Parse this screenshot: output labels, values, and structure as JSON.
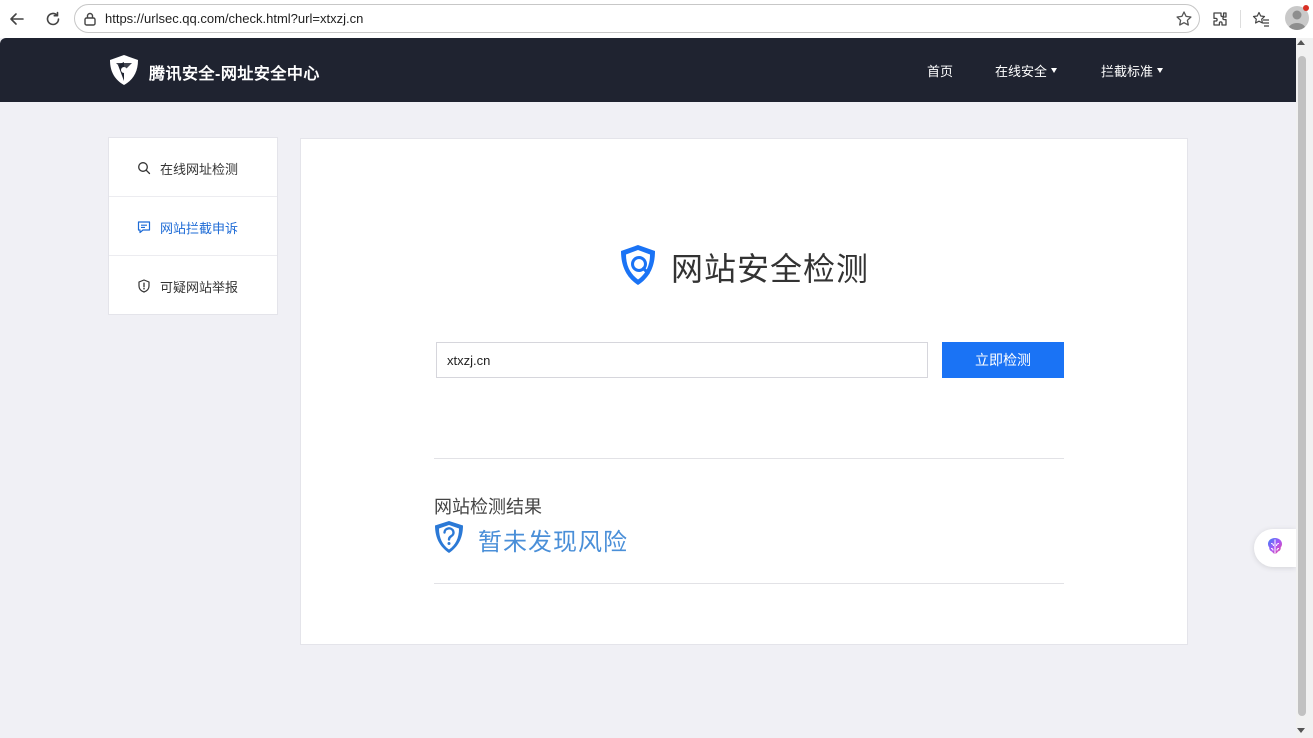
{
  "browser": {
    "url": "https://urlsec.qq.com/check.html?url=xtxzj.cn",
    "icons": [
      "back-arrow-icon",
      "reload-icon",
      "lock-icon",
      "star-icon",
      "extensions-icon",
      "favorites-icon",
      "profile-icon"
    ]
  },
  "header": {
    "brand": "腾讯安全-网址安全中心",
    "nav": [
      {
        "label": "首页",
        "dropdown": false
      },
      {
        "label": "在线安全",
        "dropdown": true
      },
      {
        "label": "拦截标准",
        "dropdown": true
      }
    ]
  },
  "sidebar": {
    "items": [
      {
        "label": "在线网址检测",
        "icon": "search-icon",
        "active": false
      },
      {
        "label": "网站拦截申诉",
        "icon": "message-icon",
        "active": true
      },
      {
        "label": "可疑网站举报",
        "icon": "shield-alert-icon",
        "active": false
      }
    ]
  },
  "main": {
    "title": "网站安全检测",
    "search": {
      "value": "xtxzj.cn",
      "button_label": "立即检测"
    },
    "result": {
      "heading": "网站检测结果",
      "status": "暂未发现风险"
    }
  },
  "colors": {
    "header_bg": "#1f2330",
    "page_bg": "#f0f0f5",
    "accent": "#1a73f5",
    "result_blue": "#4a8fd8",
    "active_link": "#1e6bd6"
  }
}
